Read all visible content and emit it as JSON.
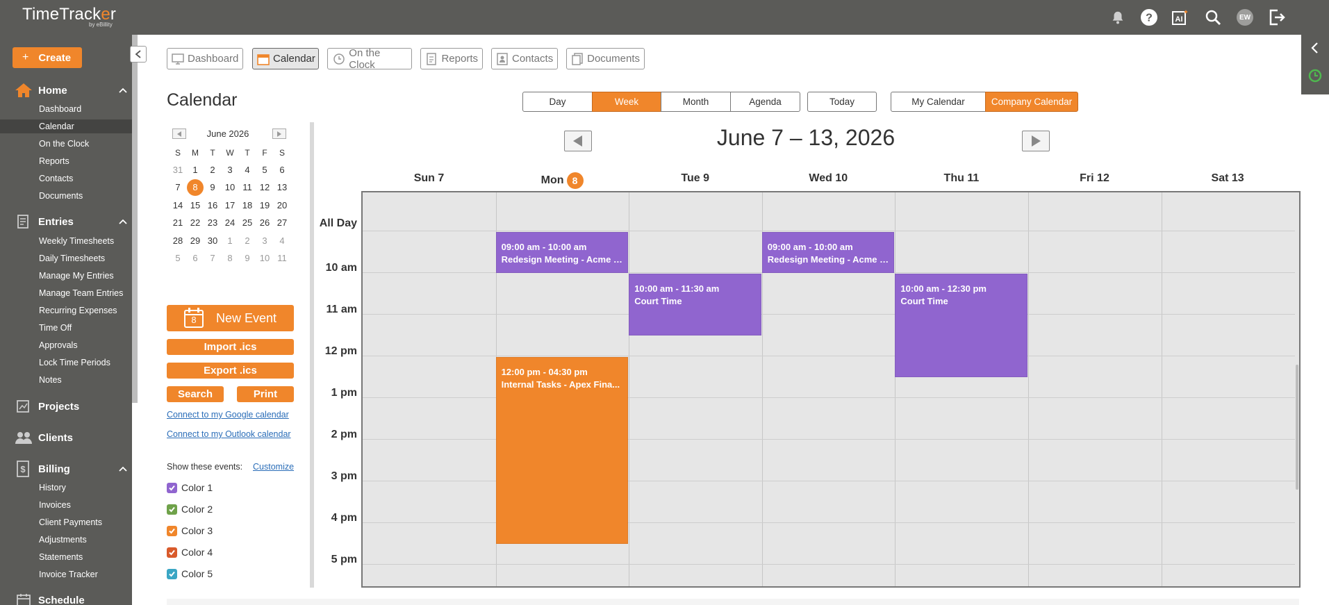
{
  "app": {
    "logo_text_a": "TimeTrack",
    "logo_text_o": "e",
    "logo_text_b": "r",
    "logo_sub": "by eBillity",
    "user_initials": "EW"
  },
  "sidebar": {
    "create_label": "Create",
    "sections": [
      {
        "label": "Home",
        "items": [
          "Dashboard",
          "Calendar",
          "On the Clock",
          "Reports",
          "Contacts",
          "Documents"
        ]
      },
      {
        "label": "Entries",
        "items": [
          "Weekly Timesheets",
          "Daily Timesheets",
          "Manage My Entries",
          "Manage Team Entries",
          "Recurring Expenses",
          "Time Off",
          "Approvals",
          "Lock Time Periods",
          "Notes"
        ]
      },
      {
        "label": "Projects",
        "items": []
      },
      {
        "label": "Clients",
        "items": []
      },
      {
        "label": "Billing",
        "items": [
          "History",
          "Invoices",
          "Client Payments",
          "Adjustments",
          "Statements",
          "Invoice Tracker"
        ]
      },
      {
        "label": "Schedule",
        "items": []
      }
    ],
    "active_item": "Calendar"
  },
  "module_tabs": [
    "Dashboard",
    "Calendar",
    "On the Clock",
    "Reports",
    "Contacts",
    "Documents"
  ],
  "page": {
    "title": "Calendar"
  },
  "views": {
    "day": "Day",
    "week": "Week",
    "month": "Month",
    "agenda": "Agenda",
    "today": "Today",
    "my_calendar": "My Calendar",
    "company_calendar": "Company Calendar",
    "active_view": "Week",
    "active_calendar": "Company Calendar"
  },
  "mini_calendar": {
    "month_label": "June 2026",
    "dow": [
      "S",
      "M",
      "T",
      "W",
      "T",
      "F",
      "S"
    ],
    "weeks": [
      [
        "31",
        "1",
        "2",
        "3",
        "4",
        "5",
        "6"
      ],
      [
        "7",
        "8",
        "9",
        "10",
        "11",
        "12",
        "13"
      ],
      [
        "14",
        "15",
        "16",
        "17",
        "18",
        "19",
        "20"
      ],
      [
        "21",
        "22",
        "23",
        "24",
        "25",
        "26",
        "27"
      ],
      [
        "28",
        "29",
        "30",
        "1",
        "2",
        "3",
        "4"
      ],
      [
        "5",
        "6",
        "7",
        "8",
        "9",
        "10",
        "11"
      ]
    ],
    "today": "8"
  },
  "actions": {
    "new_event": "New Event",
    "new_event_icon_day": "8",
    "import": "Import .ics",
    "export": "Export .ics",
    "search": "Search",
    "print": "Print",
    "google": "Connect to my Google calendar",
    "outlook": "Connect to my Outlook calendar"
  },
  "filters": {
    "label": "Show these events:",
    "customize": "Customize",
    "colors": [
      {
        "label": "Color 1",
        "color": "#9065cf",
        "checked": true
      },
      {
        "label": "Color 2",
        "color": "#6fa24a",
        "checked": true
      },
      {
        "label": "Color 3",
        "color": "#f0862b",
        "checked": true
      },
      {
        "label": "Color 4",
        "color": "#d95a2b",
        "checked": true
      },
      {
        "label": "Color 5",
        "color": "#3aa6c4",
        "checked": true
      }
    ]
  },
  "week": {
    "title": "June 7 – 13, 2026",
    "days": [
      {
        "label": "Sun 7",
        "badge": ""
      },
      {
        "label": "Mon",
        "badge": "8"
      },
      {
        "label": "Tue 9",
        "badge": ""
      },
      {
        "label": "Wed 10",
        "badge": ""
      },
      {
        "label": "Thu 11",
        "badge": ""
      },
      {
        "label": "Fri 12",
        "badge": ""
      },
      {
        "label": "Sat 13",
        "badge": ""
      }
    ],
    "time_labels": [
      "All Day",
      "10 am",
      "11 am",
      "12 pm",
      "1 pm",
      "2 pm",
      "3 pm",
      "4 pm",
      "5 pm"
    ],
    "events": [
      {
        "day": 1,
        "start": 9,
        "end": 10,
        "time": "09:00 am - 10:00 am",
        "title": "Redesign Meeting - Acme S...",
        "color": "purple"
      },
      {
        "day": 3,
        "start": 9,
        "end": 10,
        "time": "09:00 am - 10:00 am",
        "title": "Redesign Meeting - Acme S...",
        "color": "purple"
      },
      {
        "day": 2,
        "start": 10,
        "end": 11.5,
        "time": "10:00 am - 11:30 am",
        "title": "Court Time",
        "color": "purple"
      },
      {
        "day": 4,
        "start": 10,
        "end": 12.5,
        "time": "10:00 am - 12:30 pm",
        "title": "Court Time",
        "color": "purple"
      },
      {
        "day": 1,
        "start": 12,
        "end": 16.5,
        "time": "12:00 pm - 04:30 pm",
        "title": "Internal Tasks - Apex Fina...",
        "color": "orange"
      }
    ]
  }
}
